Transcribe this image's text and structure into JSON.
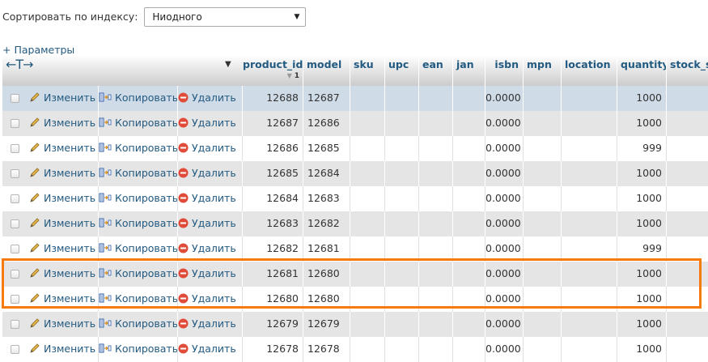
{
  "sort": {
    "label": "Сортировать по индексу:",
    "selected": "Ниодного"
  },
  "params_link": "+ Параметры",
  "columns": [
    "product_id",
    "model",
    "sku",
    "upc",
    "ean",
    "jan",
    "isbn",
    "mpn",
    "location",
    "quantity",
    "stock_s"
  ],
  "actions": {
    "edit": "Изменить",
    "copy": "Копировать",
    "delete": "Удалить"
  },
  "rows": [
    {
      "product_id": "12688",
      "model": "12687",
      "isbn": "0.0000",
      "quantity": "1000"
    },
    {
      "product_id": "12687",
      "model": "12686",
      "isbn": "0.0000",
      "quantity": "1000"
    },
    {
      "product_id": "12686",
      "model": "12685",
      "isbn": "0.0000",
      "quantity": "999"
    },
    {
      "product_id": "12685",
      "model": "12684",
      "isbn": "0.0000",
      "quantity": "1000"
    },
    {
      "product_id": "12684",
      "model": "12683",
      "isbn": "0.0000",
      "quantity": "1000"
    },
    {
      "product_id": "12683",
      "model": "12682",
      "isbn": "0.0000",
      "quantity": "1000"
    },
    {
      "product_id": "12682",
      "model": "12681",
      "isbn": "0.0000",
      "quantity": "999"
    },
    {
      "product_id": "12681",
      "model": "12680",
      "isbn": "0.0000",
      "quantity": "1000"
    },
    {
      "product_id": "12680",
      "model": "12680",
      "isbn": "0.0000",
      "quantity": "1000"
    },
    {
      "product_id": "12679",
      "model": "12679",
      "isbn": "0.0000",
      "quantity": "1000"
    },
    {
      "product_id": "12678",
      "model": "12678",
      "isbn": "0.0000",
      "quantity": "1000"
    }
  ],
  "sort_indicator": "1",
  "colors": {
    "link": "#235a81",
    "highlight": "#f77b0c",
    "row_selected": "#cfdbe6",
    "row_even": "#e5e5e5"
  }
}
